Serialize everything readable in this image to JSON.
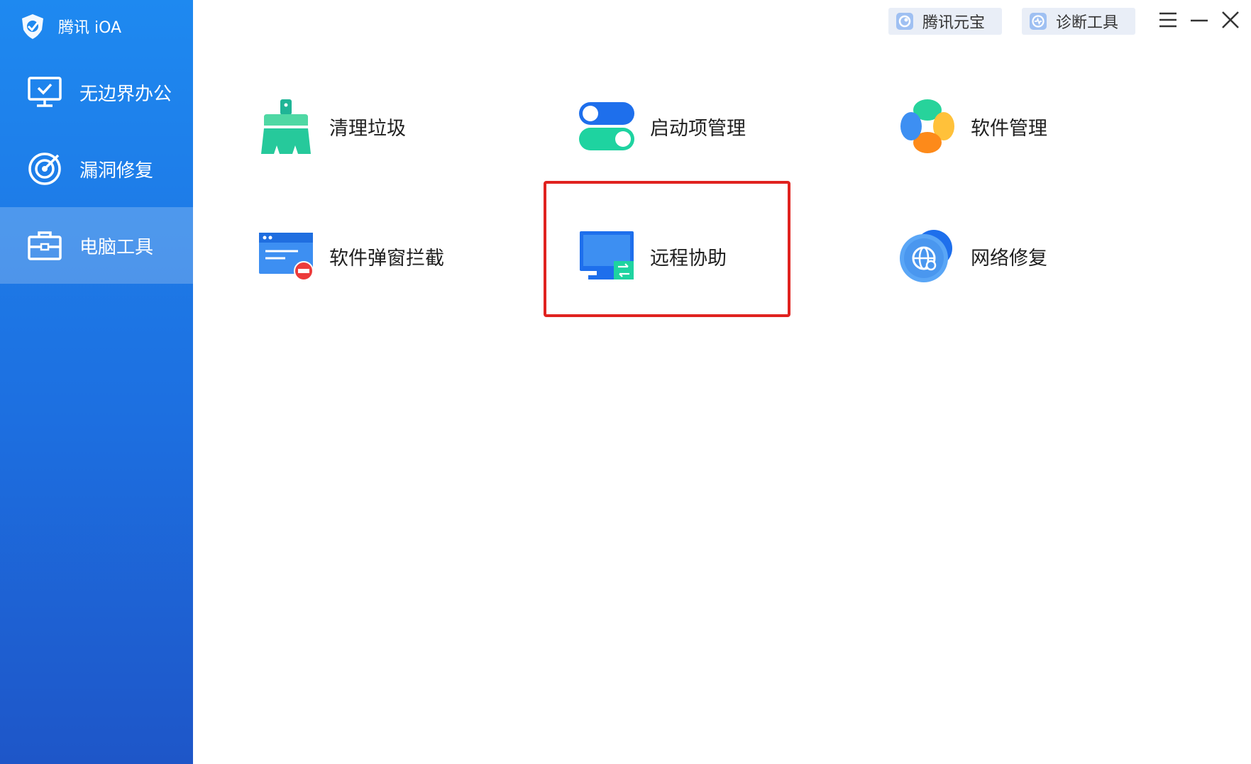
{
  "app": {
    "brand_name": "腾讯 iOA"
  },
  "sidebar": {
    "items": [
      {
        "label": "无边界办公",
        "icon": "monitor-check-icon"
      },
      {
        "label": "漏洞修复",
        "icon": "target-icon"
      },
      {
        "label": "电脑工具",
        "icon": "toolbox-icon",
        "active": true
      }
    ]
  },
  "topbar": {
    "yuanbao_label": "腾讯元宝",
    "diagnose_label": "诊断工具"
  },
  "tools": [
    {
      "label": "清理垃圾",
      "icon": "broom-icon"
    },
    {
      "label": "启动项管理",
      "icon": "toggle-switch-icon"
    },
    {
      "label": "软件管理",
      "icon": "clover-apps-icon"
    },
    {
      "label": "软件弹窗拦截",
      "icon": "popup-block-icon"
    },
    {
      "label": "远程协助",
      "icon": "remote-desktop-icon",
      "highlighted": true
    },
    {
      "label": "网络修复",
      "icon": "network-globe-icon"
    }
  ],
  "colors": {
    "sidebar_top": "#1e89f0",
    "sidebar_bottom": "#1e56c8",
    "highlight": "#e0221f"
  }
}
